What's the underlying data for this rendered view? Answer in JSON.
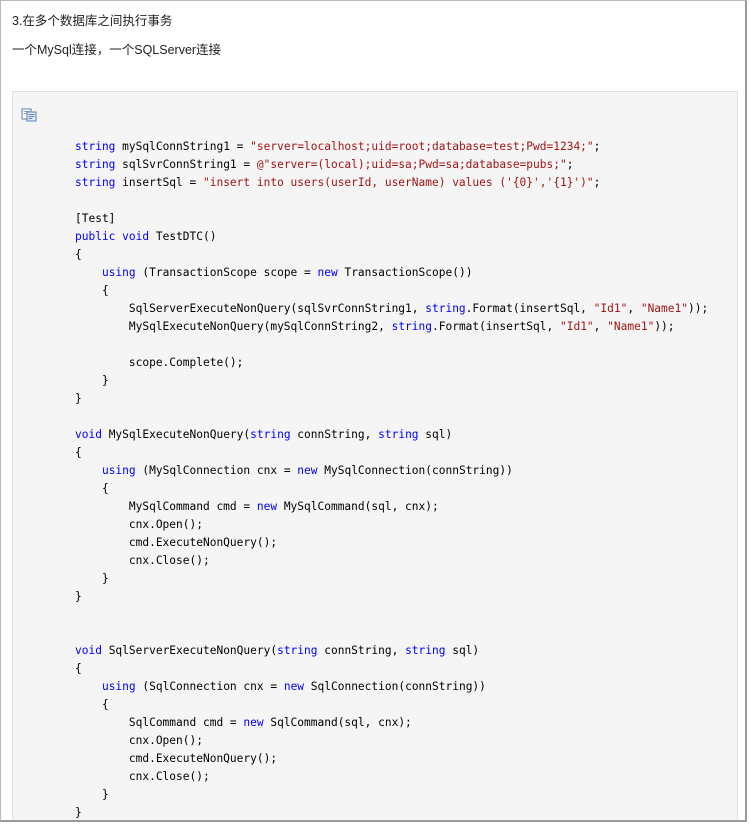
{
  "heading": "3.在多个数据库之间执行事务",
  "subheading": "一个MySql连接，一个SQLServer连接",
  "code_lines": [
    [
      [
        "kw",
        "string"
      ],
      [
        "t",
        " mySqlConnString1 = "
      ],
      [
        "str",
        "\"server=localhost;uid=root;database=test;Pwd=1234;\""
      ],
      [
        "t",
        ";"
      ]
    ],
    [
      [
        "kw",
        "string"
      ],
      [
        "t",
        " sqlSvrConnString1 = "
      ],
      [
        "str",
        "@\"server=(local);uid=sa;Pwd=sa;database=pubs;\""
      ],
      [
        "t",
        ";"
      ]
    ],
    [
      [
        "kw",
        "string"
      ],
      [
        "t",
        " insertSql = "
      ],
      [
        "str",
        "\"insert into users(userId, userName) values ('{0}','{1}')\""
      ],
      [
        "t",
        ";"
      ]
    ],
    [],
    [
      [
        "t",
        "[Test]"
      ]
    ],
    [
      [
        "kw",
        "public"
      ],
      [
        "t",
        " "
      ],
      [
        "kw",
        "void"
      ],
      [
        "t",
        " TestDTC()"
      ]
    ],
    [
      [
        "t",
        "{"
      ]
    ],
    [
      [
        "t",
        "    "
      ],
      [
        "kw",
        "using"
      ],
      [
        "t",
        " (TransactionScope scope = "
      ],
      [
        "kw",
        "new"
      ],
      [
        "t",
        " TransactionScope())"
      ]
    ],
    [
      [
        "t",
        "    {"
      ]
    ],
    [
      [
        "t",
        "        SqlServerExecuteNonQuery(sqlSvrConnString1, "
      ],
      [
        "kw",
        "string"
      ],
      [
        "t",
        ".Format(insertSql, "
      ],
      [
        "str",
        "\"Id1\""
      ],
      [
        "t",
        ", "
      ],
      [
        "str",
        "\"Name1\""
      ],
      [
        "t",
        "));"
      ]
    ],
    [
      [
        "t",
        "        MySqlExecuteNonQuery(mySqlConnString2, "
      ],
      [
        "kw",
        "string"
      ],
      [
        "t",
        ".Format(insertSql, "
      ],
      [
        "str",
        "\"Id1\""
      ],
      [
        "t",
        ", "
      ],
      [
        "str",
        "\"Name1\""
      ],
      [
        "t",
        "));"
      ]
    ],
    [],
    [
      [
        "t",
        "        scope.Complete();"
      ]
    ],
    [
      [
        "t",
        "    }"
      ]
    ],
    [
      [
        "t",
        "}"
      ]
    ],
    [],
    [
      [
        "kw",
        "void"
      ],
      [
        "t",
        " MySqlExecuteNonQuery("
      ],
      [
        "kw",
        "string"
      ],
      [
        "t",
        " connString, "
      ],
      [
        "kw",
        "string"
      ],
      [
        "t",
        " sql)"
      ]
    ],
    [
      [
        "t",
        "{"
      ]
    ],
    [
      [
        "t",
        "    "
      ],
      [
        "kw",
        "using"
      ],
      [
        "t",
        " (MySqlConnection cnx = "
      ],
      [
        "kw",
        "new"
      ],
      [
        "t",
        " MySqlConnection(connString))"
      ]
    ],
    [
      [
        "t",
        "    {"
      ]
    ],
    [
      [
        "t",
        "        MySqlCommand cmd = "
      ],
      [
        "kw",
        "new"
      ],
      [
        "t",
        " MySqlCommand(sql, cnx);"
      ]
    ],
    [
      [
        "t",
        "        cnx.Open();"
      ]
    ],
    [
      [
        "t",
        "        cmd.ExecuteNonQuery();"
      ]
    ],
    [
      [
        "t",
        "        cnx.Close();"
      ]
    ],
    [
      [
        "t",
        "    }"
      ]
    ],
    [
      [
        "t",
        "}"
      ]
    ],
    [],
    [],
    [
      [
        "kw",
        "void"
      ],
      [
        "t",
        " SqlServerExecuteNonQuery("
      ],
      [
        "kw",
        "string"
      ],
      [
        "t",
        " connString, "
      ],
      [
        "kw",
        "string"
      ],
      [
        "t",
        " sql)"
      ]
    ],
    [
      [
        "t",
        "{"
      ]
    ],
    [
      [
        "t",
        "    "
      ],
      [
        "kw",
        "using"
      ],
      [
        "t",
        " (SqlConnection cnx = "
      ],
      [
        "kw",
        "new"
      ],
      [
        "t",
        " SqlConnection(connString))"
      ]
    ],
    [
      [
        "t",
        "    {"
      ]
    ],
    [
      [
        "t",
        "        SqlCommand cmd = "
      ],
      [
        "kw",
        "new"
      ],
      [
        "t",
        " SqlCommand(sql, cnx);"
      ]
    ],
    [
      [
        "t",
        "        cnx.Open();"
      ]
    ],
    [
      [
        "t",
        "        cmd.ExecuteNonQuery();"
      ]
    ],
    [
      [
        "t",
        "        cnx.Close();"
      ]
    ],
    [
      [
        "t",
        "    }"
      ]
    ],
    [
      [
        "t",
        "}"
      ]
    ]
  ]
}
